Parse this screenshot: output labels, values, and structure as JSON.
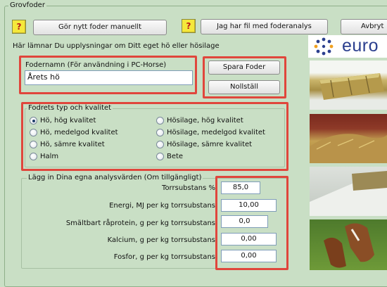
{
  "window_group_title": "Grovfoder",
  "toolbar": {
    "help_glyph": "?",
    "new_feed_button": "Gör nytt foder manuellt",
    "have_file_button": "Jag har fil med foderanalys",
    "cancel_button": "Avbryt"
  },
  "section_title": "Här lämnar Du upplysningar om Ditt eget hö eller hösilage",
  "feed_name": {
    "label": "Fodernamn (För användning i PC-Horse)",
    "value": "Årets hö"
  },
  "actions": {
    "save": "Spara Foder",
    "reset": "Nollställ"
  },
  "feed_type": {
    "title": "Fodrets typ och kvalitet",
    "options_left": [
      "Hö, hög kvalitet",
      "Hö, medelgod kvalitet",
      "Hö, sämre kvalitet",
      "Halm"
    ],
    "options_right": [
      "Hösilage, hög kvalitet",
      "Hösilage, medelgod kvalitet",
      "Hösilage, sämre kvalitet",
      "Bete"
    ],
    "selected": "Hö, hög kvalitet"
  },
  "analysis": {
    "title": "Lägg in Dina egna analysvärden (Om tillgängligt)",
    "rows": [
      {
        "label": "Torrsubstans %",
        "value": "85,0"
      },
      {
        "label": "Energi, MJ per kg torrsubstans",
        "value": "10,00"
      },
      {
        "label": "Smältbart råprotein, g per kg torrsubstans",
        "value": "0,0"
      },
      {
        "label": "Kalcium, g per kg torrsubstans",
        "value": "0,00"
      },
      {
        "label": "Fosfor, g per kg torrsubstans",
        "value": "0,00"
      }
    ]
  },
  "logo": {
    "text": "euro",
    "icon": "dotted-star-logo-icon"
  },
  "colors": {
    "background": "#c9dfc5",
    "highlight": "#e0463c",
    "help": "#f5e83b",
    "logo_blue": "#2b3f8e"
  }
}
